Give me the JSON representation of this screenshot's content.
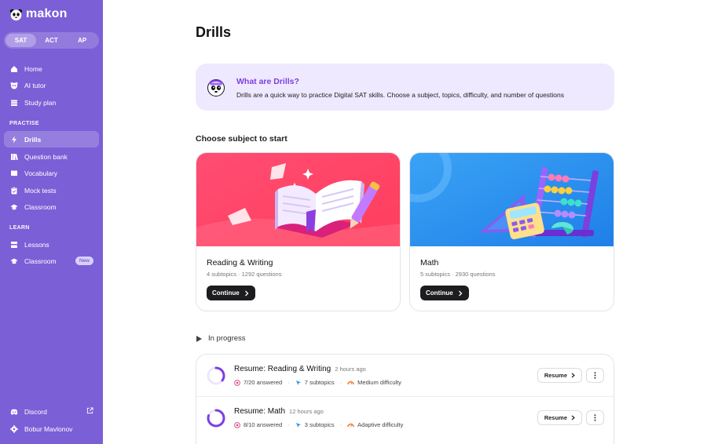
{
  "app": {
    "name": "makon"
  },
  "exam_tabs": [
    {
      "label": "SAT",
      "active": true
    },
    {
      "label": "ACT",
      "active": false
    },
    {
      "label": "AP",
      "active": false
    }
  ],
  "nav": {
    "home": "Home",
    "ai_tutor": "AI tutor",
    "study_plan": "Study plan",
    "practise_label": "PRACTISE",
    "drills": "Drills",
    "question_bank": "Question bank",
    "vocabulary": "Vocabulary",
    "mock_tests": "Mock tests",
    "classroom": "Classroom",
    "learn_label": "LEARN",
    "lessons": "Lessons",
    "classroom2": "Classroom",
    "new_badge": "New",
    "discord": "Discord",
    "user_name": "Bobur Mavlonov"
  },
  "page": {
    "title": "Drills"
  },
  "info": {
    "title": "What are Drills?",
    "text": "Drills are a quick way to practice Digital SAT skills. Choose a subject, topics, difficulty, and number of questions"
  },
  "subjects_heading": "Choose subject to start",
  "subjects": [
    {
      "title": "Reading & Writing",
      "meta": "4 subtopics · 1292 questions",
      "button": "Continue"
    },
    {
      "title": "Math",
      "meta": "5 subtopics · 2930 questions",
      "button": "Continue"
    }
  ],
  "in_progress_label": "In progress",
  "progress": [
    {
      "title": "Resume: Reading & Writing",
      "time": "2 hours ago",
      "answered": "7/20 answered",
      "subtopics": "7 subtopics",
      "difficulty": "Medium difficulty",
      "button": "Resume",
      "progress_fraction": 0.35
    },
    {
      "title": "Resume: Math",
      "time": "12 hours ago",
      "answered": "8/10 answered",
      "subtopics": "3 subtopics",
      "difficulty": "Adaptive difficulty",
      "button": "Resume",
      "progress_fraction": 0.8
    }
  ],
  "colors": {
    "sidebar": "#7b5fd6",
    "accent": "#7c3fe0",
    "info_bg": "#efe9ff",
    "rw_card": "#ff4f6d",
    "math_card": "#2f8ef0"
  }
}
